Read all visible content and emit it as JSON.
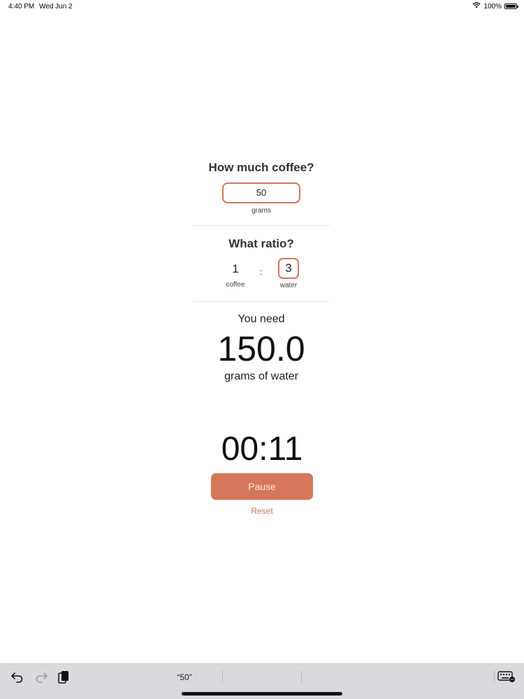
{
  "status_bar": {
    "time": "4:40 PM",
    "date": "Wed Jun 2",
    "battery": "100%"
  },
  "coffee": {
    "title": "How much coffee?",
    "value": "50",
    "unit": "grams"
  },
  "ratio": {
    "title": "What ratio?",
    "coffee_value": "1",
    "coffee_label": "coffee",
    "separator": ":",
    "water_value": "3",
    "water_label": "water"
  },
  "result": {
    "label": "You need",
    "value": "150.0",
    "unit": "grams of water"
  },
  "timer": {
    "display": "00:11",
    "pause_label": "Pause",
    "reset_label": "Reset"
  },
  "shortcut_bar": {
    "suggestion": "“50”",
    "icons": [
      "undo-icon",
      "redo-icon",
      "paste-icon",
      "keyboard-icon"
    ]
  },
  "colors": {
    "accent": "#d2775c",
    "button_bg": "#d5775a",
    "bar_bg": "#d9dade"
  }
}
